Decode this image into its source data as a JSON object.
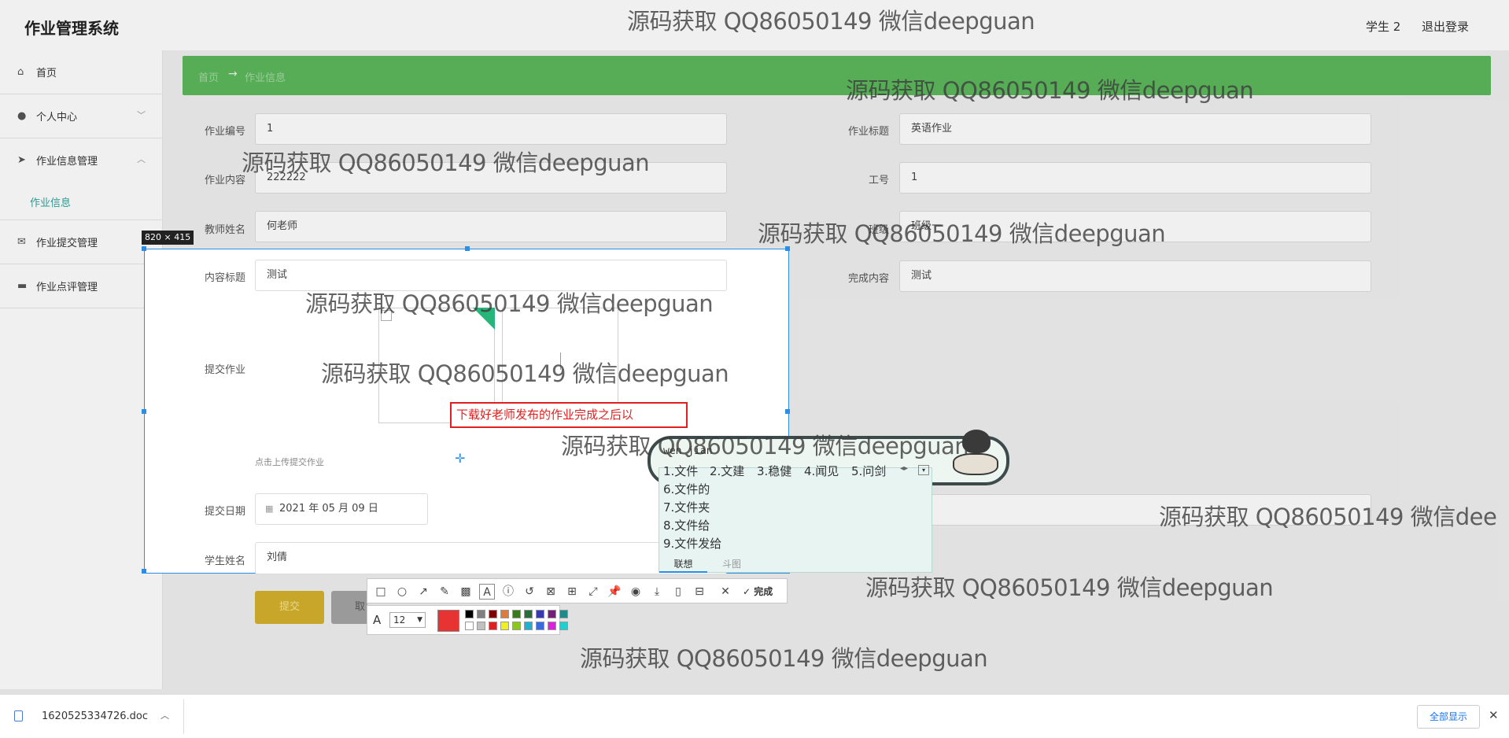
{
  "app": {
    "title": "作业管理系统",
    "user": "学生 2",
    "logout": "退出登录"
  },
  "sidebar": {
    "items": [
      {
        "label": "首页",
        "icon": "home-icon"
      },
      {
        "label": "个人中心",
        "icon": "user-icon"
      },
      {
        "label": "作业信息管理",
        "icon": "send-icon"
      },
      {
        "label": "作业提交管理",
        "icon": "mail-icon"
      },
      {
        "label": "作业点评管理",
        "icon": "monitor-icon"
      }
    ],
    "sub_item": "作业信息"
  },
  "breadcrumb": {
    "home": "首页",
    "arrow": "→",
    "current": "作业信息"
  },
  "form": {
    "hw_no_label": "作业编号",
    "hw_no": "1",
    "hw_title_label": "作业标题",
    "hw_title": "英语作业",
    "hw_content_label": "作业内容",
    "hw_content": "222222",
    "staff_no_label": "工号",
    "staff_no": "1",
    "teacher_label": "教师姓名",
    "teacher": "何老师",
    "class_label": "班级",
    "class": "班级一",
    "content_title_label": "内容标题",
    "content_title": "测试",
    "done_content_label": "完成内容",
    "done_content": "测试",
    "submit_hw_label": "提交作业",
    "upload_hint": "点击上传提交作业",
    "submit_date_label": "提交日期",
    "submit_date": "2021 年 05 月 09 日",
    "student_label": "学生姓名",
    "student": "刘倩",
    "submit_button": "提交",
    "cancel_button": "取"
  },
  "capture": {
    "size_badge": "820 × 415",
    "annotation_text": "下载好老师发布的作业完成之后以"
  },
  "ime": {
    "pinyin": "wen jian",
    "candidates_row": [
      "1.文件",
      "2.文建",
      "3.稳健",
      "4.闻见",
      "5.问剑"
    ],
    "candidates_list": [
      "6.文件的",
      "7.文件夹",
      "8.文件给",
      "9.文件发给"
    ],
    "tab_associate": "联想",
    "tab_doutu": "斗图"
  },
  "toolbar": {
    "done_label": "完成",
    "font_size": "12"
  },
  "palette": [
    "#000000",
    "#808080",
    "#800000",
    "#e07a3c",
    "#3a7a1e",
    "#2a6e3a",
    "#3a3ab0",
    "#7a1e7a",
    "#1e8a8a",
    "#ffffff",
    "#c0c0c0",
    "#e02020",
    "#f0f020",
    "#8ac820",
    "#20b0d0",
    "#3a6ae0",
    "#e020e0",
    "#20d0d0"
  ],
  "accent_color": "#e83333",
  "download": {
    "file": "1620525334726.doc",
    "show_all": "全部显示"
  },
  "watermark": "源码获取 QQ86050149 微信deepguan",
  "watermark_clipped": "源码获取 QQ86050149 微信dee"
}
